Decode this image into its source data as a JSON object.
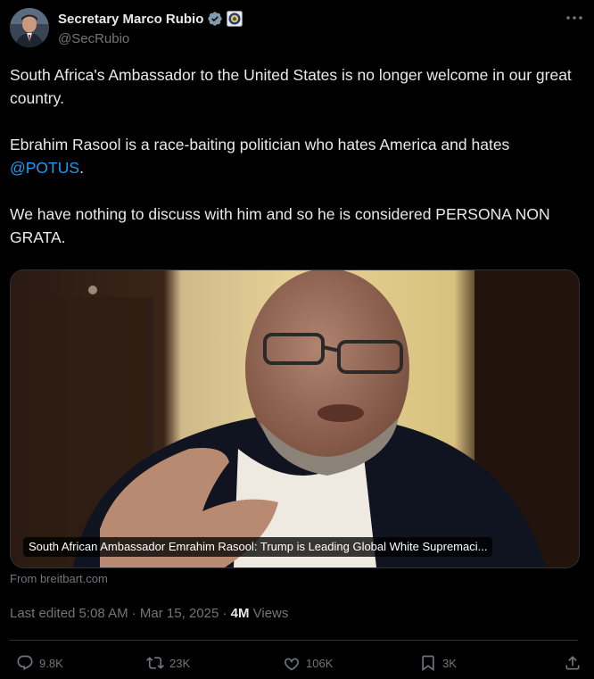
{
  "author": {
    "display_name": "Secretary Marco Rubio",
    "handle": "@SecRubio"
  },
  "tweet": {
    "para1": "South Africa's Ambassador to the United States is no longer welcome in our great country.",
    "para2_prefix": "Ebrahim Rasool is a race-baiting politician who hates America and hates ",
    "mention": "@POTUS",
    "para2_suffix": ".",
    "para3": "We have nothing to discuss with him and so he is considered PERSONA NON GRATA."
  },
  "media": {
    "caption": "South African Ambassador Emrahim Rasool: Trump is Leading Global White Supremaci...",
    "source": "From breitbart.com"
  },
  "meta": {
    "edited_prefix": "Last edited 5:08 AM · Mar 15, 2025 · ",
    "views_count": "4M",
    "views_label": " Views"
  },
  "actions": {
    "replies": "9.8K",
    "reposts": "23K",
    "likes": "106K",
    "bookmarks": "3K"
  },
  "colors": {
    "background": "#000000",
    "text": "#e7e9ea",
    "secondary": "#71767b",
    "link": "#1d9bf0",
    "divider": "#2f3336"
  }
}
